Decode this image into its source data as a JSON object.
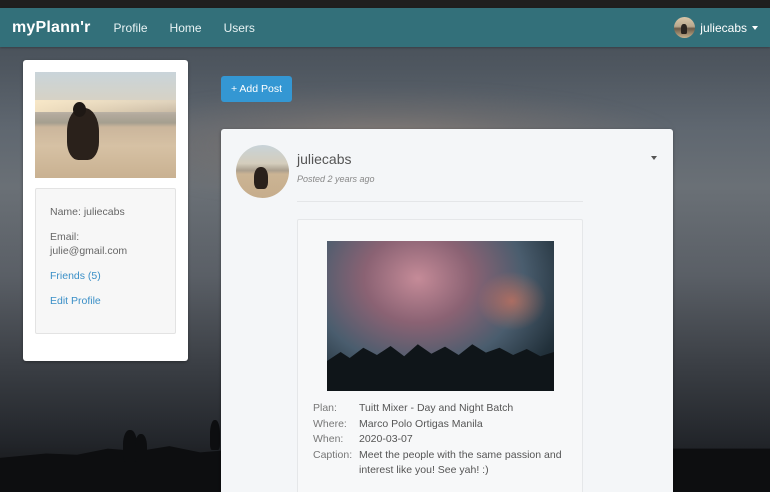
{
  "navbar": {
    "brand": "myPlann'r",
    "links": [
      "Profile",
      "Home",
      "Users"
    ],
    "user": "juliecabs"
  },
  "profile": {
    "name": "Name: juliecabs",
    "email_label": "Email:",
    "email": "julie@gmail.com",
    "friends": "Friends (5)",
    "edit": "Edit Profile"
  },
  "add_post": {
    "label": "+ Add Post"
  },
  "post": {
    "author": "juliecabs",
    "time": "Posted 2 years ago",
    "details": [
      {
        "key": "Plan:",
        "value": "Tuitt Mixer - Day and Night Batch"
      },
      {
        "key": "Where:",
        "value": "Marco Polo Ortigas Manila"
      },
      {
        "key": "When:",
        "value": "2020-03-07"
      },
      {
        "key": "Caption:",
        "value": "Meet the people with the same passion and interest like you! See yah! :)"
      }
    ]
  },
  "icons": {
    "user_menu": "chevron-down-icon",
    "post_menu": "chevron-down-icon"
  },
  "colors": {
    "navbar": "#33707a",
    "accent": "#3497d3",
    "link": "#3a8fc7"
  }
}
